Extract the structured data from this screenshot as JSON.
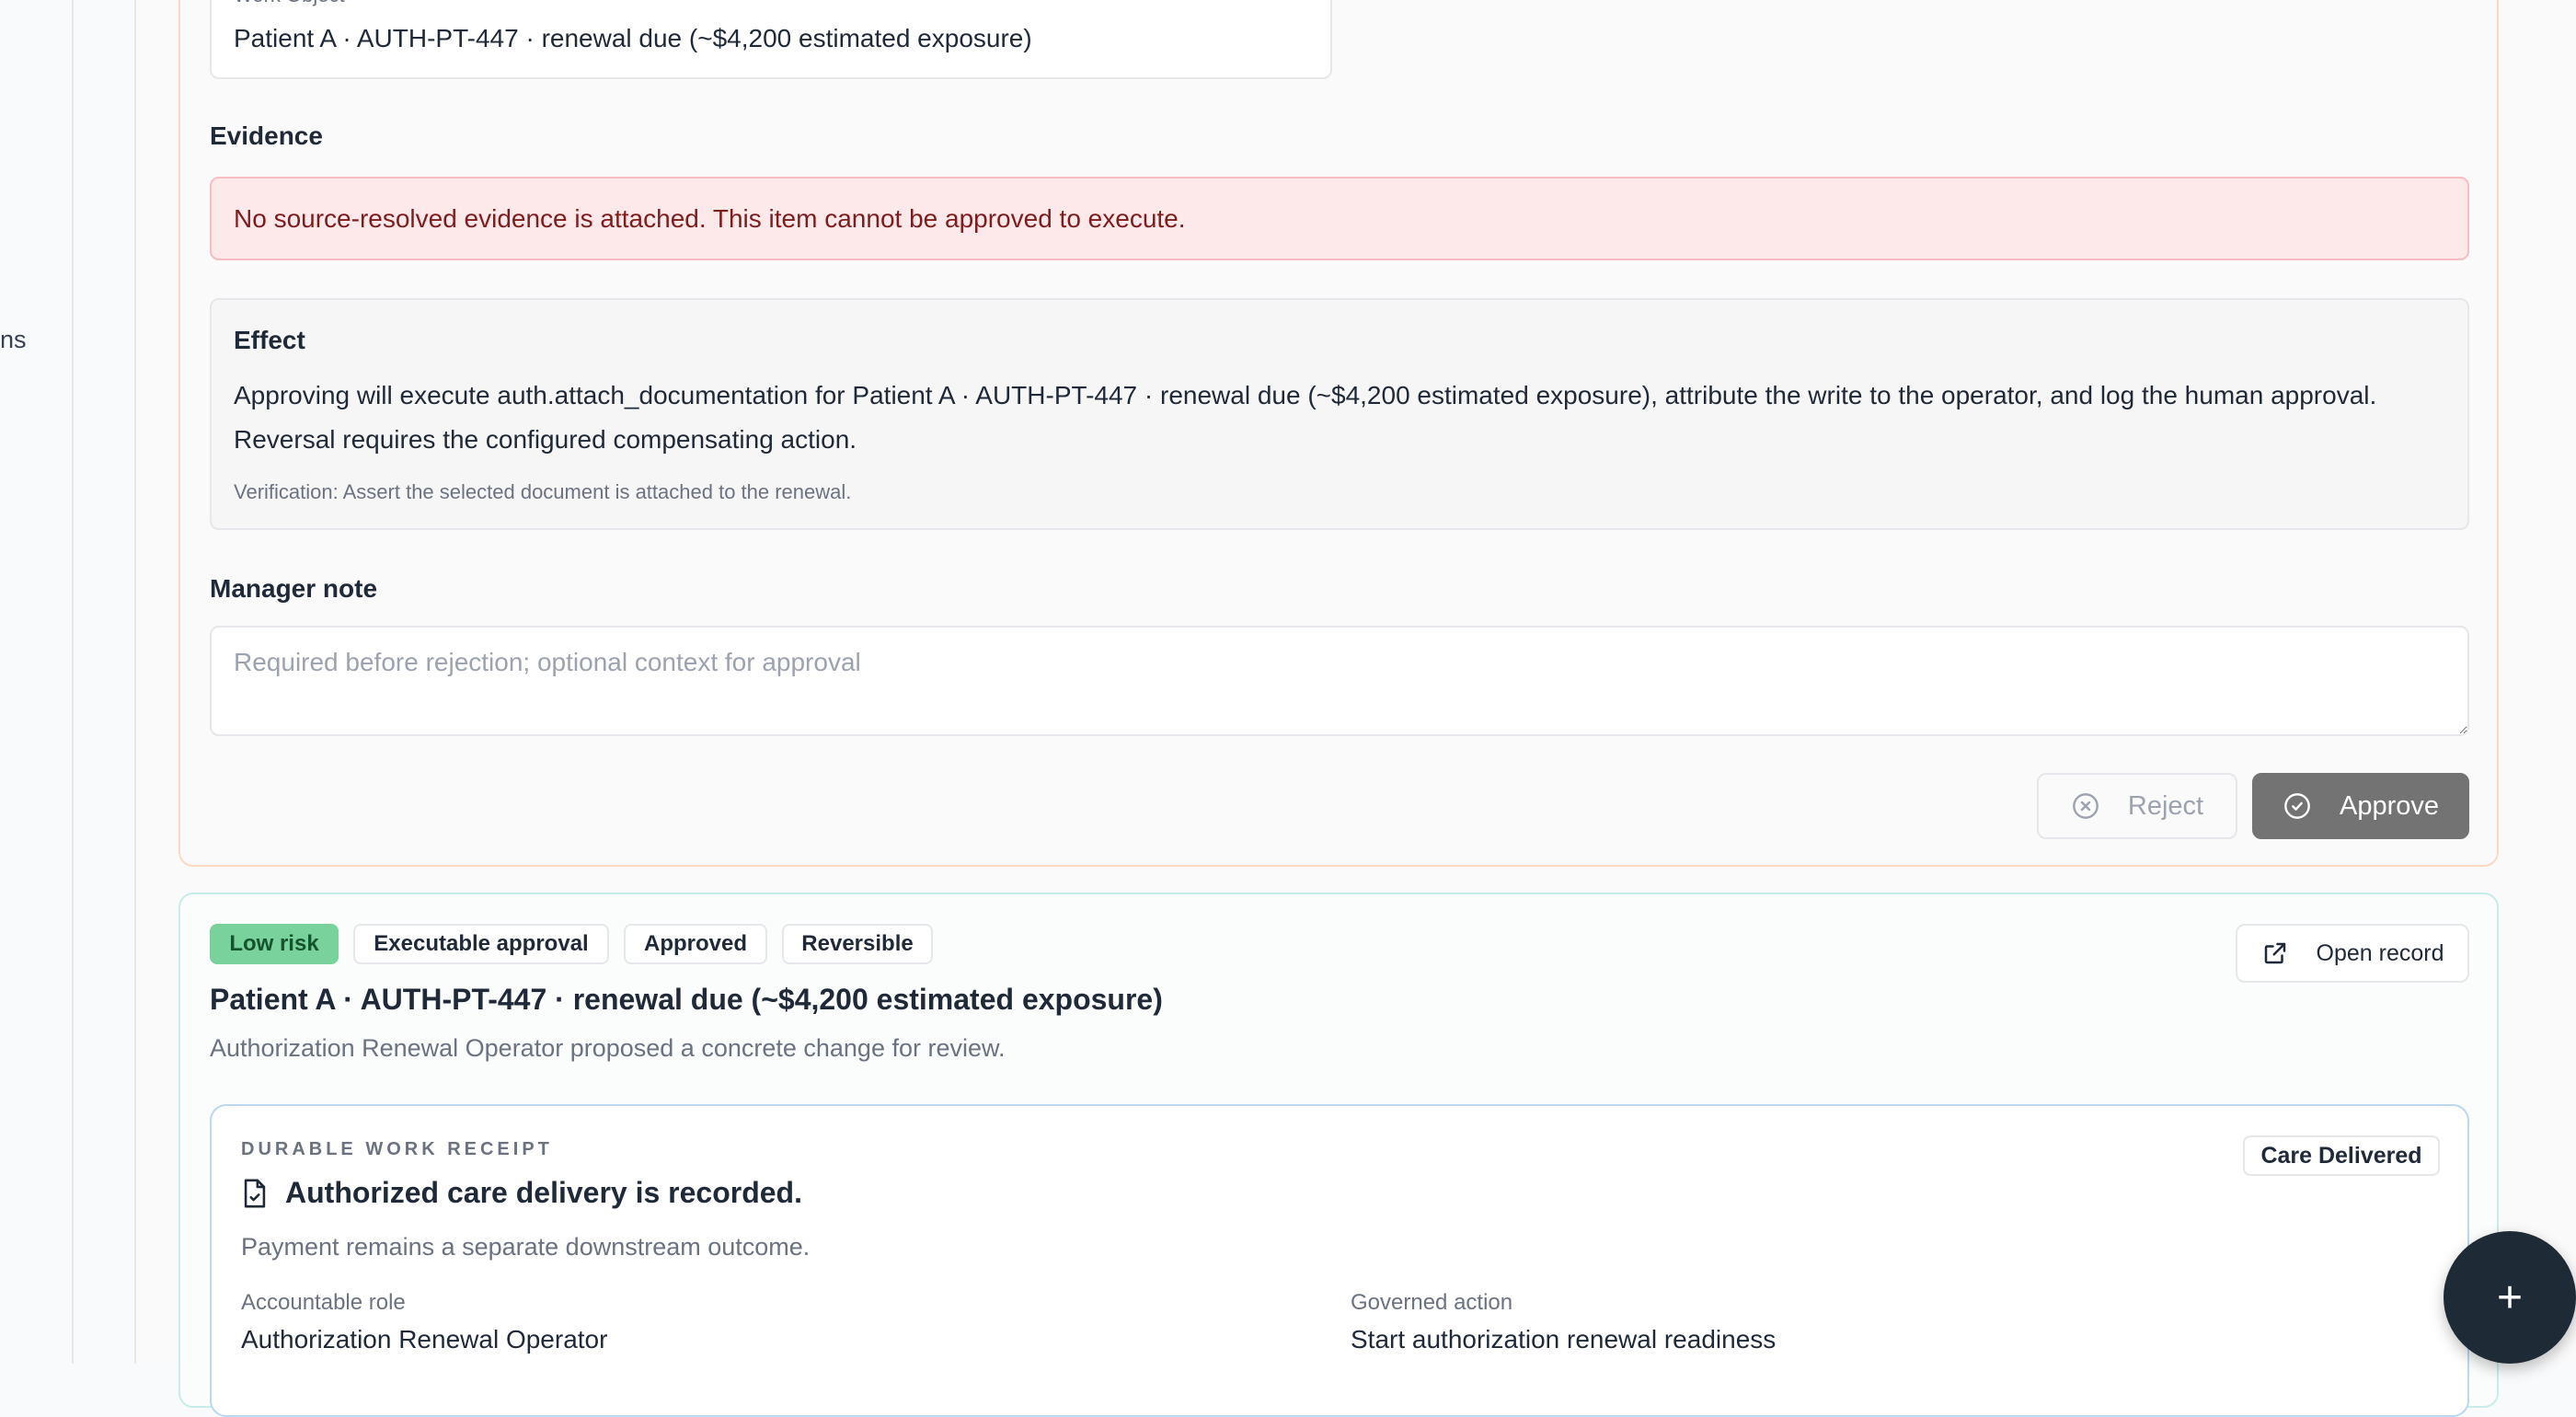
{
  "sidebar": {
    "partial_label": "ns"
  },
  "card1": {
    "work_object_label": "Work Object",
    "work_object_value": "Patient A · AUTH-PT-447 · renewal due (~$4,200 estimated exposure)",
    "evidence_title": "Evidence",
    "evidence_alert": "No source-resolved evidence is attached. This item cannot be approved to execute.",
    "effect_title": "Effect",
    "effect_body": "Approving will execute auth.attach_documentation for Patient A · AUTH-PT-447 · renewal due (~$4,200 estimated exposure), attribute the write to the operator, and log the human approval. Reversal requires the configured compensating action.",
    "verification": "Verification: Assert the selected document is attached to the renewal.",
    "manager_note_title": "Manager note",
    "manager_note_placeholder": "Required before rejection; optional context for approval",
    "manager_note_value": "",
    "reject_label": "Reject",
    "approve_label": "Approve"
  },
  "card2": {
    "badges": {
      "risk": "Low risk",
      "type": "Executable approval",
      "status": "Approved",
      "reversible": "Reversible"
    },
    "open_record_label": "Open record",
    "title": "Patient A · AUTH-PT-447 · renewal due (~$4,200 estimated exposure)",
    "subtitle": "Authorization Renewal Operator proposed a concrete change for review.",
    "receipt": {
      "kicker": "DURABLE WORK RECEIPT",
      "title": "Authorized care delivery is recorded.",
      "description": "Payment remains a separate downstream outcome.",
      "status_badge": "Care Delivered",
      "accountable_role_label": "Accountable role",
      "accountable_role_value": "Authorization Renewal Operator",
      "governed_action_label": "Governed action",
      "governed_action_value": "Start authorization renewal readiness"
    }
  },
  "fab": {
    "label": "+"
  },
  "colors": {
    "risk_low": "#79d29b",
    "alert_bg": "#fde8ea",
    "alert_text": "#7f1d1d",
    "approve_bg": "#737373",
    "fab_bg": "#1f2a37"
  }
}
